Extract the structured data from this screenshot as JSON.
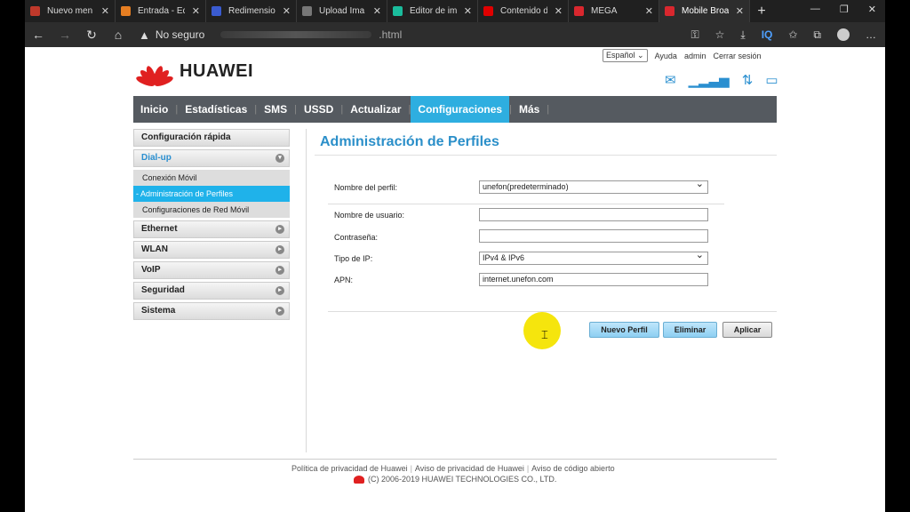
{
  "browser": {
    "tabs": [
      {
        "title": "Nuevo men",
        "color": "#c0392b"
      },
      {
        "title": "Entrada - Ed",
        "color": "#e67e22"
      },
      {
        "title": "Redimensio",
        "color": "#3a5bd0"
      },
      {
        "title": "Upload Ima",
        "color": "#777777"
      },
      {
        "title": "Editor de im",
        "color": "#1abc9c"
      },
      {
        "title": "Contenido d",
        "color": "#e00000"
      },
      {
        "title": "MEGA",
        "color": "#d9272e"
      },
      {
        "title": "Mobile Broa",
        "color": "#d9272e"
      }
    ],
    "address": {
      "security": "No seguro",
      "url_suffix": ".html"
    },
    "toolbar_iq": "IQ"
  },
  "header": {
    "language": "Español",
    "help": "Ayuda",
    "user": "admin",
    "logout": "Cerrar sesión",
    "brand": "HUAWEI"
  },
  "nav": [
    "Inicio",
    "Estadísticas",
    "SMS",
    "USSD",
    "Actualizar",
    "Configuraciones",
    "Más"
  ],
  "sidebar": {
    "quick": "Configuración rápida",
    "dialup": "Dial-up",
    "sub": [
      "Conexión Móvil",
      "- Administración de Perfiles",
      "Configuraciones de Red Móvil"
    ],
    "items": [
      "Ethernet",
      "WLAN",
      "VoIP",
      "Seguridad",
      "Sistema"
    ]
  },
  "main": {
    "title": "Administración de Perfiles",
    "fields": {
      "profile_label": "Nombre del perfil:",
      "profile_value": "unefon(predeterminado)",
      "user_label": "Nombre de usuario:",
      "user_value": "",
      "password_label": "Contraseña:",
      "password_value": "",
      "iptype_label": "Tipo de IP:",
      "iptype_value": "IPv4 & IPv6",
      "apn_label": "APN:",
      "apn_value": "internet.unefon.com"
    },
    "buttons": {
      "new": "Nuevo Perfil",
      "delete": "Eliminar",
      "apply": "Aplicar"
    }
  },
  "footer": {
    "privacy_policy": "Política de privacidad de Huawei",
    "privacy_notice": "Aviso de privacidad de Huawei",
    "open_source": "Aviso de código abierto",
    "copyright": "(C) 2006-2019 HUAWEI TECHNOLOGIES CO., LTD."
  }
}
